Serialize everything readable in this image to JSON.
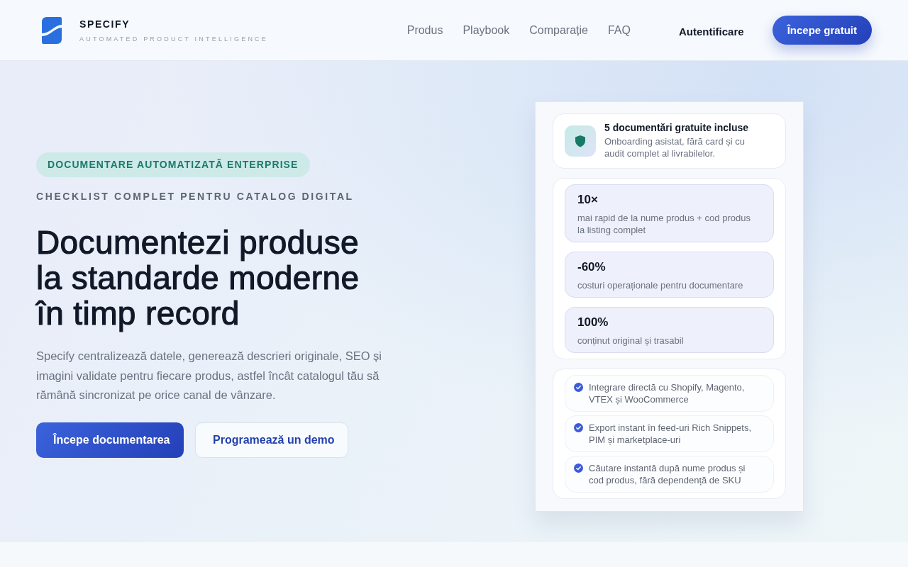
{
  "header": {
    "brand": {
      "name": "SPECIFY",
      "tagline": "AUTOMATED PRODUCT INTELLIGENCE"
    },
    "nav": [
      {
        "label": "Produs",
        "kind": "link"
      },
      {
        "label": "Playbook",
        "kind": "link"
      },
      {
        "label": "Comparație",
        "kind": "link"
      },
      {
        "label": "FAQ",
        "kind": "link"
      },
      {
        "label": "Autentificare",
        "kind": "login"
      }
    ],
    "cta": "Începe gratuit"
  },
  "hero": {
    "badge": "DOCUMENTARE AUTOMATIZATĂ ENTERPRISE",
    "eyebrow": "CHECKLIST COMPLET PENTRU CATALOG DIGITAL",
    "title_lines": [
      "Documentezi produse",
      "la standarde moderne",
      "în timp record"
    ],
    "description": "Specify centralizează datele, generează descrieri originale, SEO și imagini validate pentru fiecare produs, astfel încât catalogul tău să rămână sincronizat pe orice canal de vânzare.",
    "buttons": [
      {
        "label": "Începe documentarea",
        "kind": "primary"
      },
      {
        "label": "Programează un demo",
        "kind": "secondary"
      }
    ]
  },
  "panel": {
    "offer": {
      "title": "5 documentări gratuite incluse",
      "text": "Onboarding asistat, fără card și cu audit complet al livrabilelor."
    },
    "stats": [
      {
        "value": "10×",
        "label": "mai rapid de la nume produs + cod produs la listing complet"
      },
      {
        "value": "-60%",
        "label": "costuri operaționale pentru documentare"
      },
      {
        "value": "100%",
        "label": "conținut original și trasabil"
      }
    ],
    "features": [
      {
        "text": "Integrare directă cu Shopify, Magento, VTEX și WooCommerce",
        "checked": true
      },
      {
        "text": "Export instant în feed-uri Rich Snippets, PIM și marketplace-uri",
        "checked": true
      },
      {
        "text": "Căutare instantă după nume produs și cod produs, fără dependență de SKU",
        "checked": true
      }
    ]
  }
}
